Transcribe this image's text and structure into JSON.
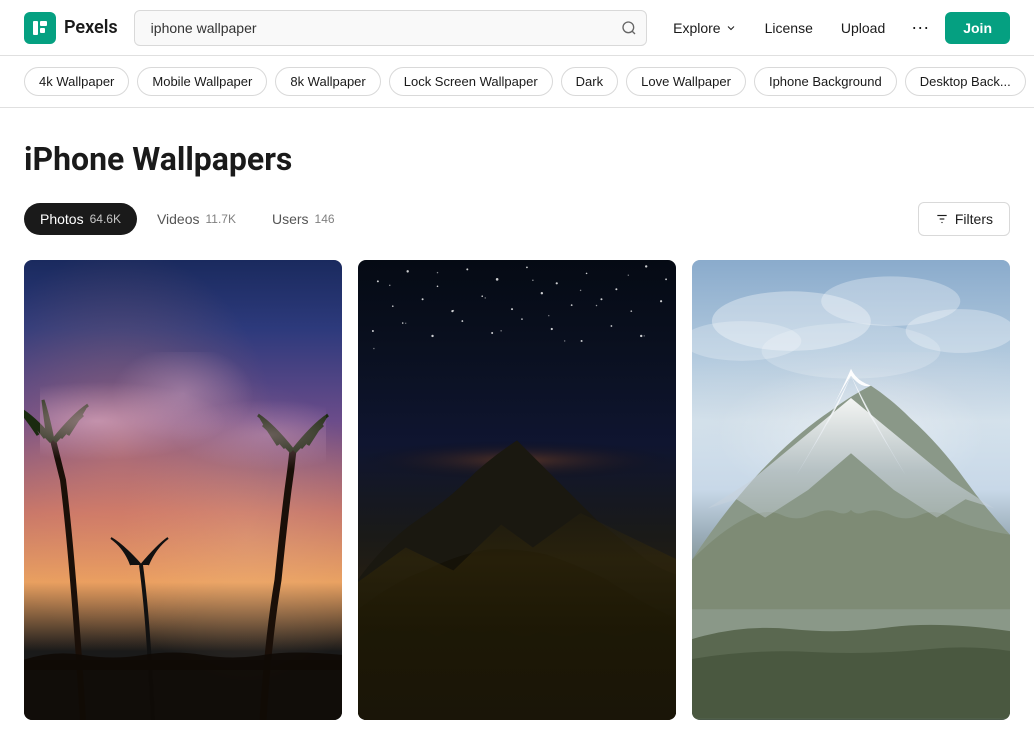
{
  "header": {
    "logo_letter": "P",
    "logo_name": "Pexels",
    "search_placeholder": "iphone wallpaper",
    "search_value": "iphone wallpaper",
    "nav": {
      "explore_label": "Explore",
      "license_label": "License",
      "upload_label": "Upload",
      "more_label": "···",
      "join_label": "Join"
    }
  },
  "tags": [
    {
      "id": "4k",
      "label": "4k Wallpaper"
    },
    {
      "id": "mobile",
      "label": "Mobile Wallpaper"
    },
    {
      "id": "8k",
      "label": "8k Wallpaper"
    },
    {
      "id": "lock",
      "label": "Lock Screen Wallpaper"
    },
    {
      "id": "dark",
      "label": "Dark"
    },
    {
      "id": "love",
      "label": "Love Wallpaper"
    },
    {
      "id": "iphone-bg",
      "label": "Iphone Background"
    },
    {
      "id": "desktop",
      "label": "Desktop Back..."
    }
  ],
  "page": {
    "title": "iPhone Wallpapers"
  },
  "tabs": [
    {
      "id": "photos",
      "label": "Photos",
      "count": "64.6K",
      "active": true
    },
    {
      "id": "videos",
      "label": "Videos",
      "count": "11.7K",
      "active": false
    },
    {
      "id": "users",
      "label": "Users",
      "count": "146",
      "active": false
    }
  ],
  "filters": {
    "label": "Filters"
  },
  "photos": [
    {
      "id": "photo-1",
      "alt": "Palm trees against sunset sky",
      "type": "palm-sunset"
    },
    {
      "id": "photo-2",
      "alt": "Night mountain with stars",
      "type": "night-mountain"
    },
    {
      "id": "photo-3",
      "alt": "Snow-capped mountain",
      "type": "snowy-mountain"
    }
  ]
}
